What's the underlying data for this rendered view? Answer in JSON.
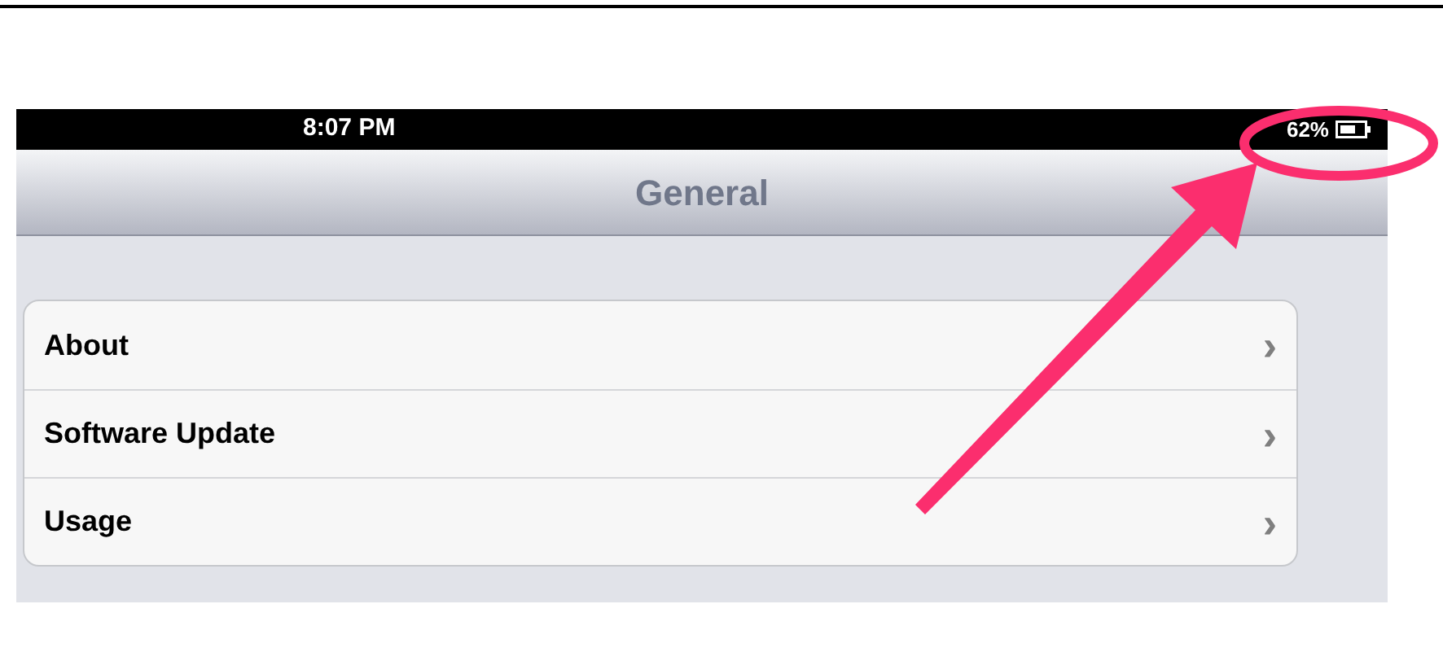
{
  "status_bar": {
    "time": "8:07 PM",
    "battery": "62%"
  },
  "nav_bar": {
    "title": "General"
  },
  "list": {
    "rows": [
      {
        "label": "About",
        "chevron": "›"
      },
      {
        "label": "Software Update",
        "chevron": "›"
      },
      {
        "label": "Usage",
        "chevron": "›"
      }
    ]
  }
}
